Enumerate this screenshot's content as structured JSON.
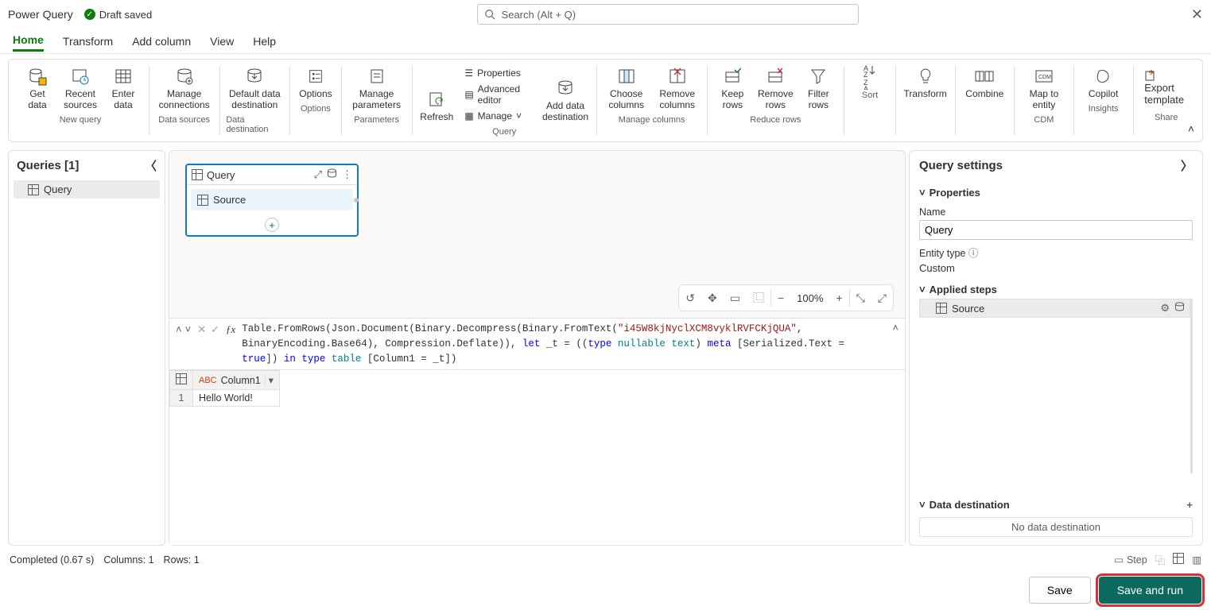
{
  "app_title": "Power Query",
  "draft_saved": "Draft saved",
  "search_placeholder": "Search (Alt + Q)",
  "tabs": [
    "Home",
    "Transform",
    "Add column",
    "View",
    "Help"
  ],
  "active_tab": 0,
  "ribbon": {
    "groups": [
      {
        "label": "New query",
        "buttons": [
          {
            "l": "Get\ndata"
          },
          {
            "l": "Recent\nsources"
          },
          {
            "l": "Enter\ndata"
          }
        ]
      },
      {
        "label": "Data sources",
        "buttons": [
          {
            "l": "Manage\nconnections"
          }
        ]
      },
      {
        "label": "Data destination",
        "buttons": [
          {
            "l": "Default data\ndestination"
          }
        ]
      },
      {
        "label": "Options",
        "buttons": [
          {
            "l": "Options"
          }
        ]
      },
      {
        "label": "Parameters",
        "buttons": [
          {
            "l": "Manage\nparameters"
          }
        ]
      },
      {
        "label": "Query",
        "buttons": [
          {
            "l": "Refresh"
          }
        ],
        "vlist": [
          {
            "l": "Properties"
          },
          {
            "l": "Advanced editor"
          },
          {
            "l": "Manage"
          }
        ],
        "extra": [
          {
            "l": "Add data\ndestination"
          }
        ]
      },
      {
        "label": "Manage columns",
        "buttons": [
          {
            "l": "Choose\ncolumns"
          },
          {
            "l": "Remove\ncolumns"
          }
        ]
      },
      {
        "label": "Reduce rows",
        "buttons": [
          {
            "l": "Keep\nrows"
          },
          {
            "l": "Remove\nrows"
          },
          {
            "l": "Filter\nrows"
          }
        ]
      },
      {
        "label": "Sort",
        "buttons": [
          {
            "l": ""
          }
        ]
      },
      {
        "label": "",
        "buttons": [
          {
            "l": "Transform"
          }
        ]
      },
      {
        "label": "",
        "buttons": [
          {
            "l": "Combine"
          }
        ]
      },
      {
        "label": "CDM",
        "buttons": [
          {
            "l": "Map to\nentity"
          }
        ]
      },
      {
        "label": "Insights",
        "buttons": [
          {
            "l": "Copilot"
          }
        ]
      },
      {
        "label": "Share",
        "buttons": [
          {
            "l": "Export template"
          }
        ]
      }
    ]
  },
  "queries_panel": {
    "title": "Queries [1]",
    "items": [
      "Query"
    ]
  },
  "diagram": {
    "query_title": "Query",
    "step": "Source"
  },
  "zoom": {
    "level": "100%"
  },
  "formula": {
    "full": "Table.FromRows(Json.Document(Binary.Decompress(Binary.FromText(\"i45W8kjNyclXCM8vyklRVFCKjQUA\", BinaryEncoding.Base64), Compression.Deflate)), let _t = ((type nullable text) meta [Serialized.Text = true]) in type table [Column1 = _t])",
    "p1": "Table.FromRows(Json.Document(Binary.Decompress(Binary.FromText(",
    "s1": "\"i45W8kjNyclXCM8vyklRVFCKjQUA\"",
    "p2": ", BinaryEncoding.Base64), Compression.Deflate)), ",
    "k1": "let",
    "p3": " _t = ((",
    "k2": "type",
    "t1": " nullable ",
    "t2": "text",
    "p4": ") ",
    "k3": "meta",
    "p5": " [Serialized.Text = ",
    "k4": "true",
    "p6": "]) ",
    "k5": "in",
    "p7": " ",
    "k6": "type",
    "p8": " ",
    "t3": "table",
    "p9": " [Column1 = _t])"
  },
  "datatable": {
    "columns": [
      "Column1"
    ],
    "rows": [
      [
        "Hello World!"
      ]
    ]
  },
  "query_settings": {
    "title": "Query settings",
    "properties": "Properties",
    "name_label": "Name",
    "name_value": "Query",
    "entity_type_label": "Entity type",
    "entity_type_value": "Custom",
    "applied_steps": "Applied steps",
    "steps": [
      "Source"
    ],
    "data_destination": "Data destination",
    "no_data_destination": "No data destination"
  },
  "statusbar": {
    "completed": "Completed (0.67 s)",
    "columns": "Columns: 1",
    "rows": "Rows: 1",
    "step": "Step"
  },
  "footer": {
    "save": "Save",
    "save_and_run": "Save and run"
  }
}
